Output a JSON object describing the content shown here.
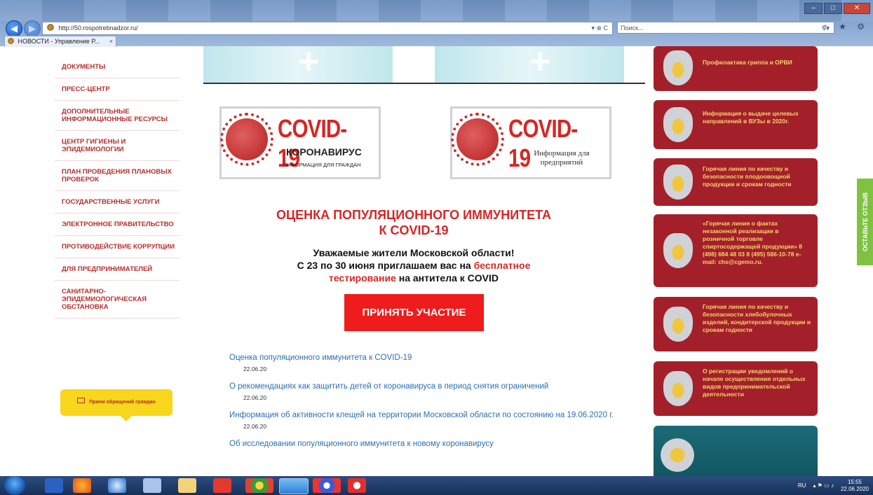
{
  "browser": {
    "url": "http://50.rospotrebnadzor.ru/",
    "search_placeholder": "Поиск...",
    "tab_title": "НОВОСТИ - Управление Р...",
    "tab_close": "×",
    "address_controls": "▾ ⊗ C",
    "right_icons": "⌂ ★ ⚙"
  },
  "sidebar": {
    "items": [
      {
        "label": "ДОКУМЕНТЫ"
      },
      {
        "label": "ПРЕСС-ЦЕНТР"
      },
      {
        "label": "ДОПОЛНИТЕЛЬНЫЕ ИНФОРМАЦИОННЫЕ РЕСУРСЫ"
      },
      {
        "label": "ЦЕНТР ГИГИЕНЫ И ЭПИДЕМИОЛОГИИ"
      },
      {
        "label": "ПЛАН ПРОВЕДЕНИЯ ПЛАНОВЫХ ПРОВЕРОК"
      },
      {
        "label": "ГОСУДАРСТВЕННЫЕ УСЛУГИ"
      },
      {
        "label": "ЭЛЕКТРОННОЕ ПРАВИТЕЛЬСТВО"
      },
      {
        "label": "ПРОТИВОДЕЙСТВИЕ КОРРУПЦИИ"
      },
      {
        "label": "ДЛЯ ПРЕДПРИНИМАТЕЛЕЙ"
      },
      {
        "label": "САНИТАРНО-ЭПИДЕМИОЛОГИЧЕСКАЯ ОБСТАНОВКА"
      }
    ],
    "appeal_button": "Прием обращений граждан"
  },
  "banners": {
    "citizens": {
      "title": "COVID-19",
      "line1": "КОРОНАВИРУС",
      "line2": "ИНФОРМАЦИЯ ДЛЯ ГРАЖДАН"
    },
    "business": {
      "title": "COVID-19",
      "line1": "Информация для предприятий"
    }
  },
  "promo": {
    "title_line1": "ОЦЕНКА ПОПУЛЯЦИОННОГО ИММУНИТЕТА",
    "title_line2": "К COVID-19",
    "text_line1": "Уважаемые жители Московской области!",
    "text_line2_a": "С 23 по 30 июня приглашаем вас на",
    "text_line2_red": "бесплатное",
    "text_line3_red": "тестирование",
    "text_line3_b": "на антитела к COVID",
    "button": "ПРИНЯТЬ УЧАСТИЕ"
  },
  "news": [
    {
      "title": "Оценка популяционного иммунитета к COVID-19",
      "date": "22.06.20"
    },
    {
      "title": "О рекомендациях как защитить детей от коронавируса в период снятия ограничений",
      "date": "22.06.20"
    },
    {
      "title": "Информация об активности клещей на территории Московской области по состоянию на 19.06.2020 г.",
      "date": "22.06.20"
    },
    {
      "title": "Об исследовании популяционного иммунитета к новому коронавирусу",
      "date": ""
    }
  ],
  "right_cards": [
    {
      "text": "Профилактика гриппа и ОРВИ"
    },
    {
      "text": "Информация о выдаче целевых направлений в ВУЗы в 2020г."
    },
    {
      "text": "Горячая линия по качеству и безопасности плодоовощной продукции и срокам годности"
    },
    {
      "text": "«Горячая линия о фактах незаконной реализации в розничной торговле спиртосодержащей продукции» 8 (498) 684 48 03 8 (495) 586-10-78 e-mail: chs@cgemo.ru."
    },
    {
      "text": "Горячая линия по качеству и безопасности хлебобулочных изделий, кондитерской продукции и срокам годности"
    },
    {
      "text": "О регистрации уведомлений о начале осуществления отдельных видов предпринимательской деятельности"
    }
  ],
  "feedback_tab": "ОСТАВЬТЕ ОТЗЫВ",
  "taskbar": {
    "lang": "RU",
    "time": "15:55",
    "date": "22.06.2020"
  },
  "colors": {
    "brand_red": "#d82525",
    "card_red": "#a3202a",
    "link_blue": "#2a6fb8",
    "feedback_green": "#7fc241"
  }
}
